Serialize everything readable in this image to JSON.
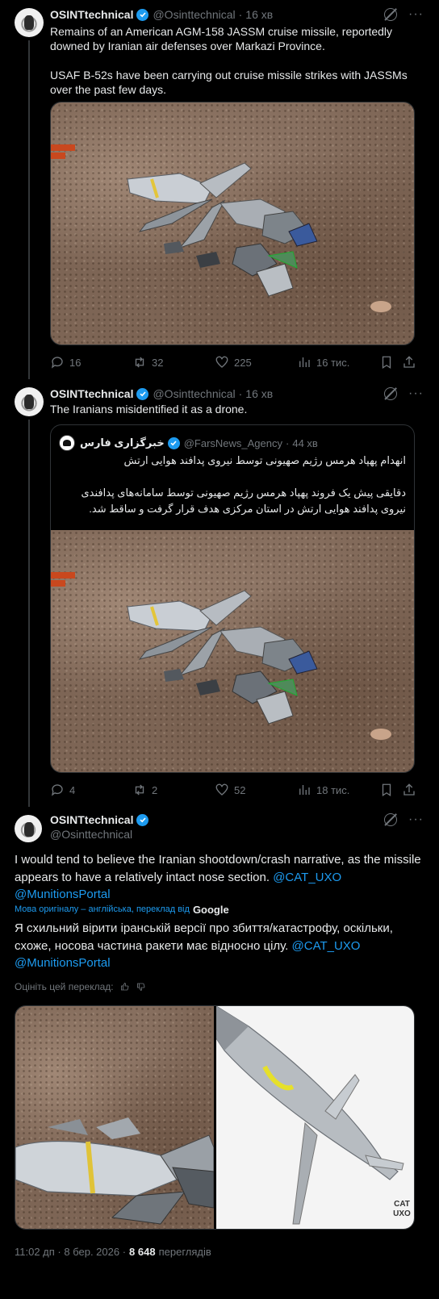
{
  "tweet1": {
    "name": "OSINTtechnical",
    "handle": "@Osinttechnical",
    "time": "16 хв",
    "text_line1": "Remains of an American AGM-158 JASSM cruise missile, reportedly downed by Iranian air defenses over Markazi Province.",
    "text_line2": "USAF B-52s have been carrying out cruise missile strikes with JASSMs over the past few days.",
    "replies": "16",
    "reposts": "32",
    "likes": "225",
    "views": "16 тис."
  },
  "tweet2": {
    "name": "OSINTtechnical",
    "handle": "@Osinttechnical",
    "time": "16 хв",
    "text": "The Iranians misidentified it as a drone.",
    "replies": "4",
    "reposts": "2",
    "likes": "52",
    "views": "18 тис.",
    "quote": {
      "name": "خبرگزاری فارس",
      "handle": "@FarsNews_Agency",
      "time": "44 хв",
      "line1": "انهدام پهپاد هرمس رژیم صهیونی توسط نیروی پدافند هوایی ارتش",
      "line2": "دقایقی پیش یک فروند پهپاد هرمس رژیم صهیونی توسط سامانه‌های پدافندی نیروی پدافند هوایی ارتش در استان مرکزی هدف قرار گرفت و ساقط شد."
    }
  },
  "tweet3": {
    "name": "OSINTtechnical",
    "handle": "@Osinttechnical",
    "text": "I would tend to believe the Iranian shootdown/crash narrative, as the missile appears to have a relatively intact nose section.",
    "mention1": "@CAT_UXO",
    "mention2": "@MunitionsPortal",
    "translation_note": "Мова оригіналу – англійська, переклад від",
    "google": "Google",
    "translated_text": "Я схильний вірити іранській версії про збиття/катастрофу, оскільки, схоже, носова частина ракети має відносно цілу.",
    "rate_label": "Оцініть цей переклад:",
    "watermark": "CAT UXO",
    "footer_time": "11:02 дп · 8 бер. 2026 ·",
    "footer_views": "8 648",
    "footer_views_label": "переглядів"
  }
}
